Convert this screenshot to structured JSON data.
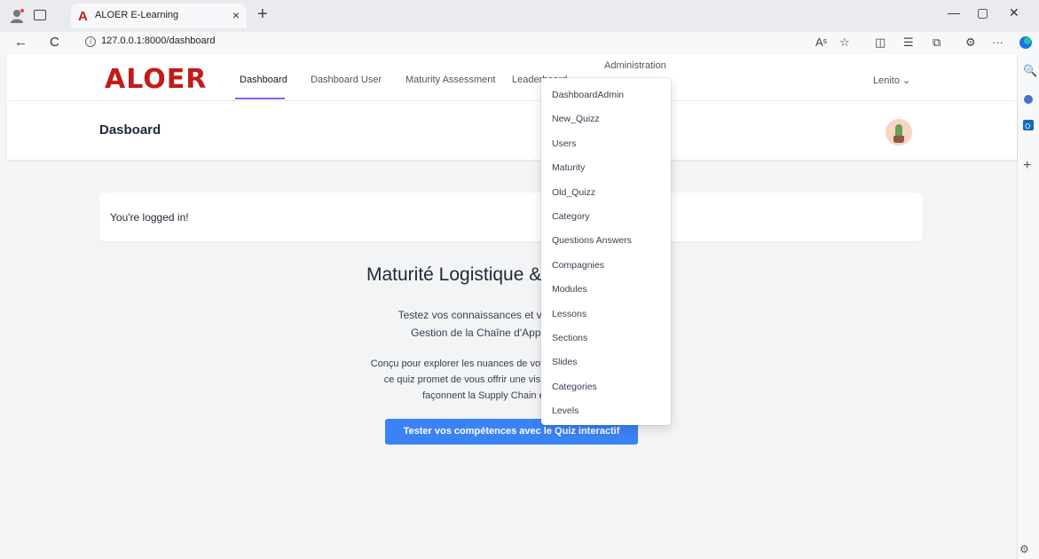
{
  "browser": {
    "tab_title": "ALOER E-Learning",
    "tab_favicon": "A",
    "tab_close": "×",
    "new_tab": "+",
    "url": "127.0.0.1:8000/dashboard",
    "back": "←",
    "reload": "C",
    "info": "i",
    "minimize": "—",
    "restore": "▢",
    "close": "✕",
    "read_aloud": "Aˢ",
    "favorite": "☆",
    "split": "◫",
    "favorites_list": "☰",
    "collections": "⧉",
    "extensions": "⚙",
    "more": "···",
    "rail_search": "🔍",
    "rail_add": "+",
    "settings": "⚙"
  },
  "nav": {
    "logo": "ALOER",
    "links": [
      "Dashboard",
      "Dashboard User",
      "Maturity Assessment",
      "Leaderboard"
    ],
    "admin": "Administration",
    "user": "Lenito ⌄"
  },
  "page": {
    "title": "Dasboard",
    "logged_in": "You're logged in!",
    "hero_title": "Maturité Logistique & Supply Chain",
    "hero_sub_1": "Testez vos connaissances et vos préjugés sur la",
    "hero_sub_2": "Gestion de la Chaîne d'Approvisionnement",
    "hero_desc_1": "Conçu pour explorer les nuances de votre Maturité Supply Chain,",
    "hero_desc_2": "ce quiz promet de vous offrir une vision 360° des forces qui",
    "hero_desc_3": "façonnent la Supply Chain et la logistique",
    "cta": "Tester vos compétences avec le Quiz interactif"
  },
  "dropdown": {
    "items": [
      "DashboardAdmin",
      "New_Quizz",
      "Users",
      "Maturity",
      "Old_Quizz",
      "Category",
      "Questions Answers",
      "Compagnies",
      "Modules",
      "Lessons",
      "Sections",
      "Slides",
      "Categories",
      "Levels"
    ]
  }
}
